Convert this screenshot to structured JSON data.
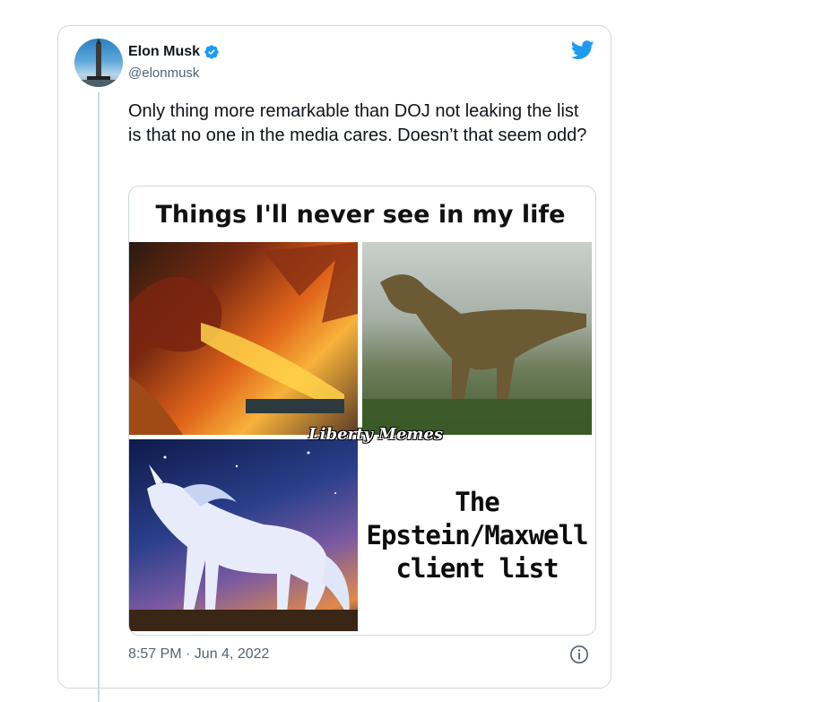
{
  "author": {
    "name": "Elon Musk",
    "handle": "@elonmusk",
    "verified": true
  },
  "tweet": {
    "text": "Only thing more remarkable than DOJ not leaking the list is that no one in the media cares. Doesn’t that seem odd?",
    "timestamp": "8:57 PM · Jun 4, 2022"
  },
  "meme": {
    "title": "Things I'll never see in my life",
    "panels": [
      "dragon",
      "t-rex",
      "unicorn",
      "text"
    ],
    "text_line1": "The",
    "text_line2": "Epstein/Maxwell",
    "text_line3": "client list",
    "watermark": "Liberty Memes"
  },
  "icons": {
    "logo": "twitter-bird-icon",
    "verified": "verified-badge-icon",
    "info": "info-icon"
  },
  "colors": {
    "brand": "#1d9bf0",
    "text": "#0f1419",
    "secondary": "#536471",
    "border": "#cfd9de"
  }
}
